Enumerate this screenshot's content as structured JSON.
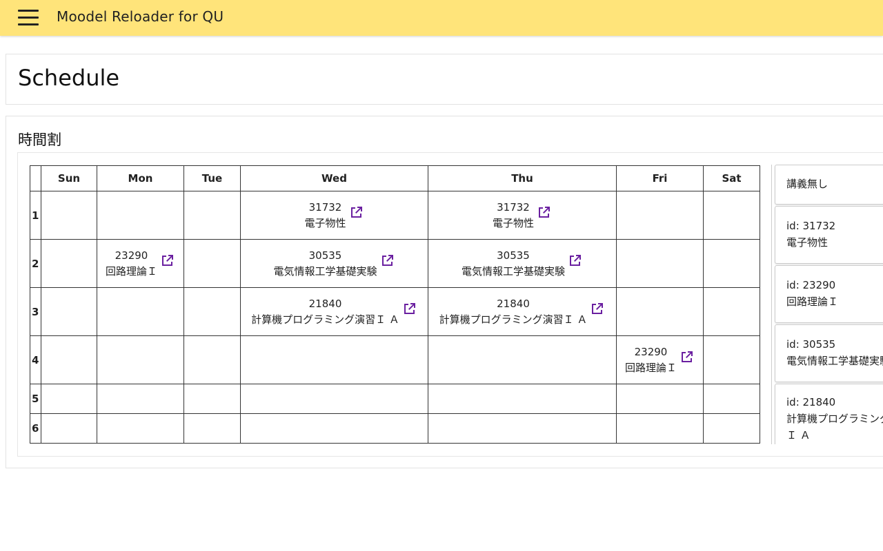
{
  "app": {
    "title": "Moodel Reloader for QU"
  },
  "page": {
    "title": "Schedule"
  },
  "section": {
    "title": "時間割"
  },
  "timetable": {
    "days": [
      "Sun",
      "Mon",
      "Tue",
      "Wed",
      "Thu",
      "Fri",
      "Sat"
    ],
    "periods": [
      "1",
      "2",
      "3",
      "4",
      "5",
      "6"
    ],
    "courses": {
      "c31732": {
        "id": "31732",
        "name": "電子物性"
      },
      "c30535": {
        "id": "30535",
        "name": "電気情報工学基礎実験"
      },
      "c23290": {
        "id": "23290",
        "name": "回路理論Ｉ"
      },
      "c21840": {
        "id": "21840",
        "name": "計算機プログラミング演習Ｉ Ａ"
      }
    }
  },
  "side_list": {
    "no_lecture": "講義無し",
    "items": [
      {
        "id_label": "id: 31732",
        "name": "電子物性"
      },
      {
        "id_label": "id: 23290",
        "name": "回路理論Ｉ"
      },
      {
        "id_label": "id: 30535",
        "name": "電気情報工学基礎実験"
      },
      {
        "id_label": "id: 21840",
        "name": "計算機プログラミング演習",
        "name2": "Ｉ Ａ"
      }
    ]
  },
  "colors": {
    "appbar": "#ffe47a",
    "link_icon": "#6a1fa0"
  },
  "icons": {
    "menu": "hamburger-icon",
    "link": "open-in-new-icon"
  }
}
